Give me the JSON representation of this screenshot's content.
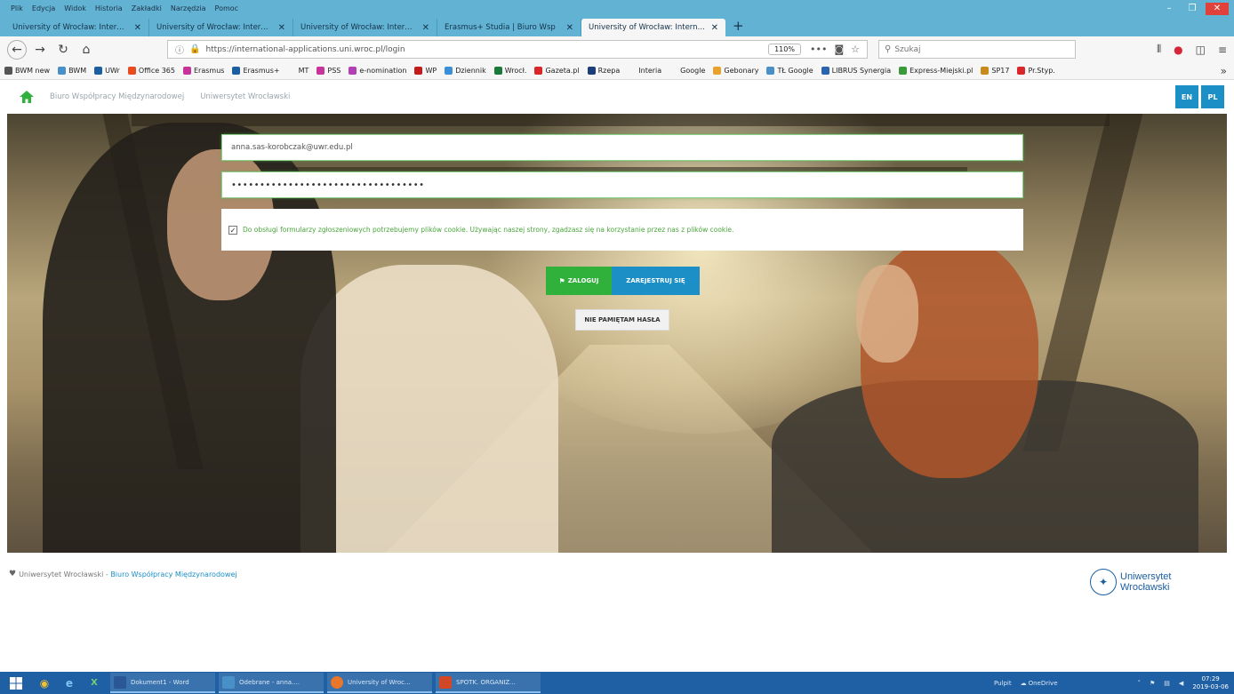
{
  "browser": {
    "menu": [
      "Plik",
      "Edycja",
      "Widok",
      "Historia",
      "Zakładki",
      "Narzędzia",
      "Pomoc"
    ],
    "tabs": [
      {
        "label": "University of Wrocław: Internati"
      },
      {
        "label": "University of Wrocław: Internati"
      },
      {
        "label": "University of Wrocław: Internati"
      },
      {
        "label": "Erasmus+ Studia | Biuro Wsp"
      },
      {
        "label": "University of Wrocław: Internati"
      }
    ],
    "new_tab": "+",
    "url": "https://international-applications.uni.wroc.pl/login",
    "zoom": "110%",
    "search_placeholder": "Szukaj",
    "bookmarks": [
      {
        "label": "BWM new",
        "color": "#555555"
      },
      {
        "label": "BWM",
        "color": "#4a90c8"
      },
      {
        "label": "UWr",
        "color": "#1b5fa0"
      },
      {
        "label": "Office 365",
        "color": "#e84c1d"
      },
      {
        "label": "Erasmus",
        "color": "#c7329b"
      },
      {
        "label": "Erasmus+",
        "color": "#1b5fa0"
      },
      {
        "label": "MT",
        "color": "#f6f6f6"
      },
      {
        "label": "PSS",
        "color": "#c7329b"
      },
      {
        "label": "e-nomination",
        "color": "#b23fb3"
      },
      {
        "label": "WP",
        "color": "#c41a1a"
      },
      {
        "label": "Dziennik",
        "color": "#3b8fd6"
      },
      {
        "label": "Wrocł.",
        "color": "#1b7a3a"
      },
      {
        "label": "Gazeta.pl",
        "color": "#d9262b"
      },
      {
        "label": "Rzepa",
        "color": "#1b3e7a"
      },
      {
        "label": "Interia",
        "color": "#f6f6f6"
      },
      {
        "label": "Google",
        "color": "#f6f6f6"
      },
      {
        "label": "Gebonary",
        "color": "#e8a12a"
      },
      {
        "label": "TŁ Google",
        "color": "#4a90c8"
      },
      {
        "label": "LIBRUS Synergia",
        "color": "#2a63b0"
      },
      {
        "label": "Express-Miejski.pl",
        "color": "#3a9a3a"
      },
      {
        "label": "SP17",
        "color": "#c88a1a"
      },
      {
        "label": "Pr.Styp.",
        "color": "#d9262b"
      }
    ]
  },
  "header": {
    "links": [
      "Biuro Współpracy Międzynarodowej",
      "Uniwersytet Wrocławski"
    ],
    "lang_en": "EN",
    "lang_pl": "PL"
  },
  "login": {
    "email_value": "anna.sas-korobczak@uwr.edu.pl",
    "password_value": "••••••••••••••••••••••••••••••••••",
    "cookie_checked": "✓",
    "cookie_text": "Do obsługi formularzy zgłoszeniowych potrzebujemy plików cookie. Używając naszej strony, zgadzasz się na korzystanie przez nas z plików cookie.",
    "login_label": "ZALOGUJ",
    "register_label": "ZAREJESTRUJ SIĘ",
    "forgot_label": "NIE PAMIĘTAM HASŁA"
  },
  "footer": {
    "org": "Uniwersytet Wrocławski",
    "separator": " - ",
    "link": "Biuro Współpracy Międzynarodowej",
    "logo_line1": "Uniwersytet",
    "logo_line2": "Wrocławski"
  },
  "taskbar": {
    "apps": [
      {
        "label": "Dokument1 - Word",
        "color": "#2b5797"
      },
      {
        "label": "Odebrane - anna....",
        "color": "#4a90c8"
      },
      {
        "label": "University of Wroc...",
        "color": "#e8762b"
      },
      {
        "label": "SPOTK. ORGANIZ...",
        "color": "#d24726"
      }
    ],
    "tray_desktop": "Pulpit",
    "tray_onedrive": "OneDrive",
    "time": "07:29",
    "date": "2019-03-06"
  },
  "colors": {
    "accent_blue": "#1b8fc6",
    "login_green": "#2fb13b",
    "cookie_green": "#4aa63c",
    "browser_chrome": "#62b3d3",
    "taskbar": "#1f5fa3"
  }
}
